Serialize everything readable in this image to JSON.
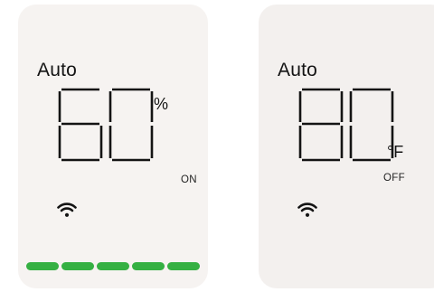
{
  "cards": [
    {
      "mode": "Auto",
      "value": "60",
      "unit": "%",
      "power_state": "ON",
      "wifi_icon": "wifi-icon",
      "level_bar": {
        "segments": 5,
        "filled": 5,
        "color": "#35b043"
      }
    },
    {
      "mode": "Auto",
      "value": "80",
      "unit": "°F",
      "power_state": "OFF",
      "wifi_icon": "wifi-icon"
    }
  ],
  "colors": {
    "card_bg": "#f6f3f1",
    "text": "#141414",
    "accent_green": "#35b043"
  }
}
